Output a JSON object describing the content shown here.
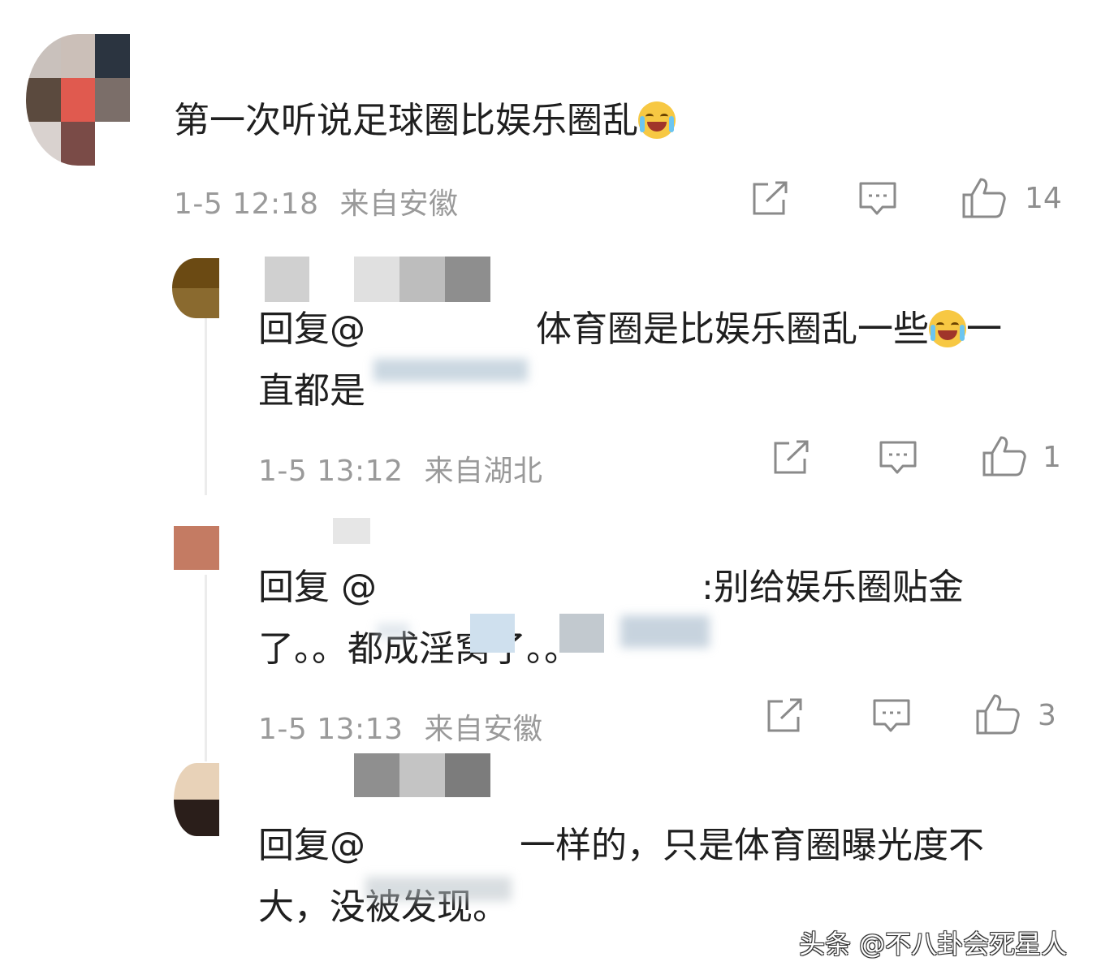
{
  "comments": [
    {
      "text": "第一次听说足球圈比娱乐圈乱",
      "emoji": "laugh-cry-emoji",
      "date": "1-5 12:18",
      "location": "来自安徽",
      "likes": "14"
    },
    {
      "reply_prefix": "回复@",
      "line1": "体育圈是比娱乐圈乱一些",
      "after_emoji": "一",
      "line2": "直都是",
      "emoji": "laugh-cry-emoji",
      "date": "1-5 13:12",
      "location": "来自湖北",
      "likes": "1"
    },
    {
      "reply_prefix": "回复 @",
      "line1": ":别给娱乐圈贴金",
      "line2": "了。。都成淫窝了。。",
      "date": "1-5 13:13",
      "location": "来自安徽",
      "likes": "3"
    },
    {
      "reply_prefix": "回复@",
      "line1": "一样的，只是体育圈曝光度不",
      "line2": "大，没被发现。"
    }
  ],
  "watermark": "头条 @不八卦会死星人",
  "icons": [
    "share-icon",
    "comment-icon",
    "thumbs-up-icon"
  ]
}
